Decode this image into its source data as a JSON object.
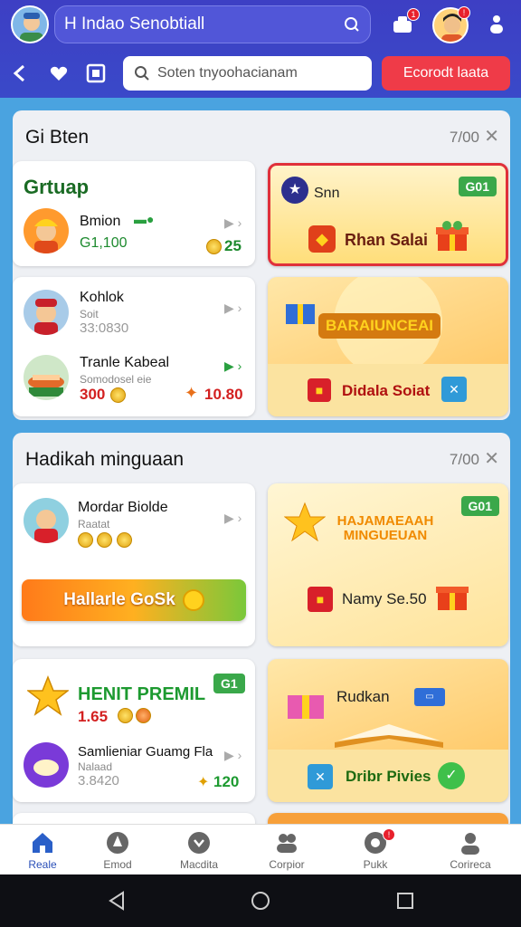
{
  "header": {
    "title": "H Indao Senobtiall",
    "search_placeholder": "Soten tnyoohacianam",
    "action_button": "Ecorodt laata",
    "notif_badge": "1",
    "avatar_badge": "!"
  },
  "section1": {
    "title": "Gi Bten",
    "count": "7/00",
    "card1": {
      "title": "Grtuap",
      "row": {
        "name": "Bmion",
        "value": "G1,100",
        "coins": "25"
      }
    },
    "card2": {
      "row1": {
        "name": "Kohlok",
        "sub": "Soit",
        "value": "33:0830"
      },
      "row2": {
        "name": "Tranle Kabeal",
        "sub": "Somodosel eie",
        "value": "300",
        "coins": "10.80"
      }
    },
    "promo1": {
      "label": "Snn",
      "badge": "G01",
      "cta": "Rhan Salai"
    },
    "promo2": {
      "banner": "BARAIUNCEAI",
      "cta": "Didala Soiat"
    }
  },
  "section2": {
    "title": "Hadikah minguaan",
    "count": "7/00",
    "card1": {
      "name": "Mordar Biolde",
      "sub": "Raatat",
      "button": "Hallarle GoSk"
    },
    "card2": {
      "title": "HENIT PREMIL",
      "badge": "G1",
      "value": "1.65",
      "row": {
        "name": "Samlieniar Guamg Fla",
        "sub": "Nalaad",
        "value": "3.8420",
        "coins": "120"
      }
    },
    "promo1": {
      "badge": "G01",
      "banner": "HAJAMAEAAH MINGUEUAN",
      "cta": "Namy Se.50"
    },
    "promo2": {
      "label": "Rudkan",
      "cta": "Dribr Pivies"
    }
  },
  "navbar": {
    "items": [
      {
        "label": "Reale"
      },
      {
        "label": "Emod"
      },
      {
        "label": "Macdita"
      },
      {
        "label": "Corpior"
      },
      {
        "label": "Pukk"
      },
      {
        "label": "Corireca"
      }
    ],
    "badge": "!"
  },
  "colors": {
    "header": "#3d3fc4",
    "accent_red": "#ef3b48",
    "green": "#3aa84a",
    "body_bg": "#4aa3e0"
  }
}
